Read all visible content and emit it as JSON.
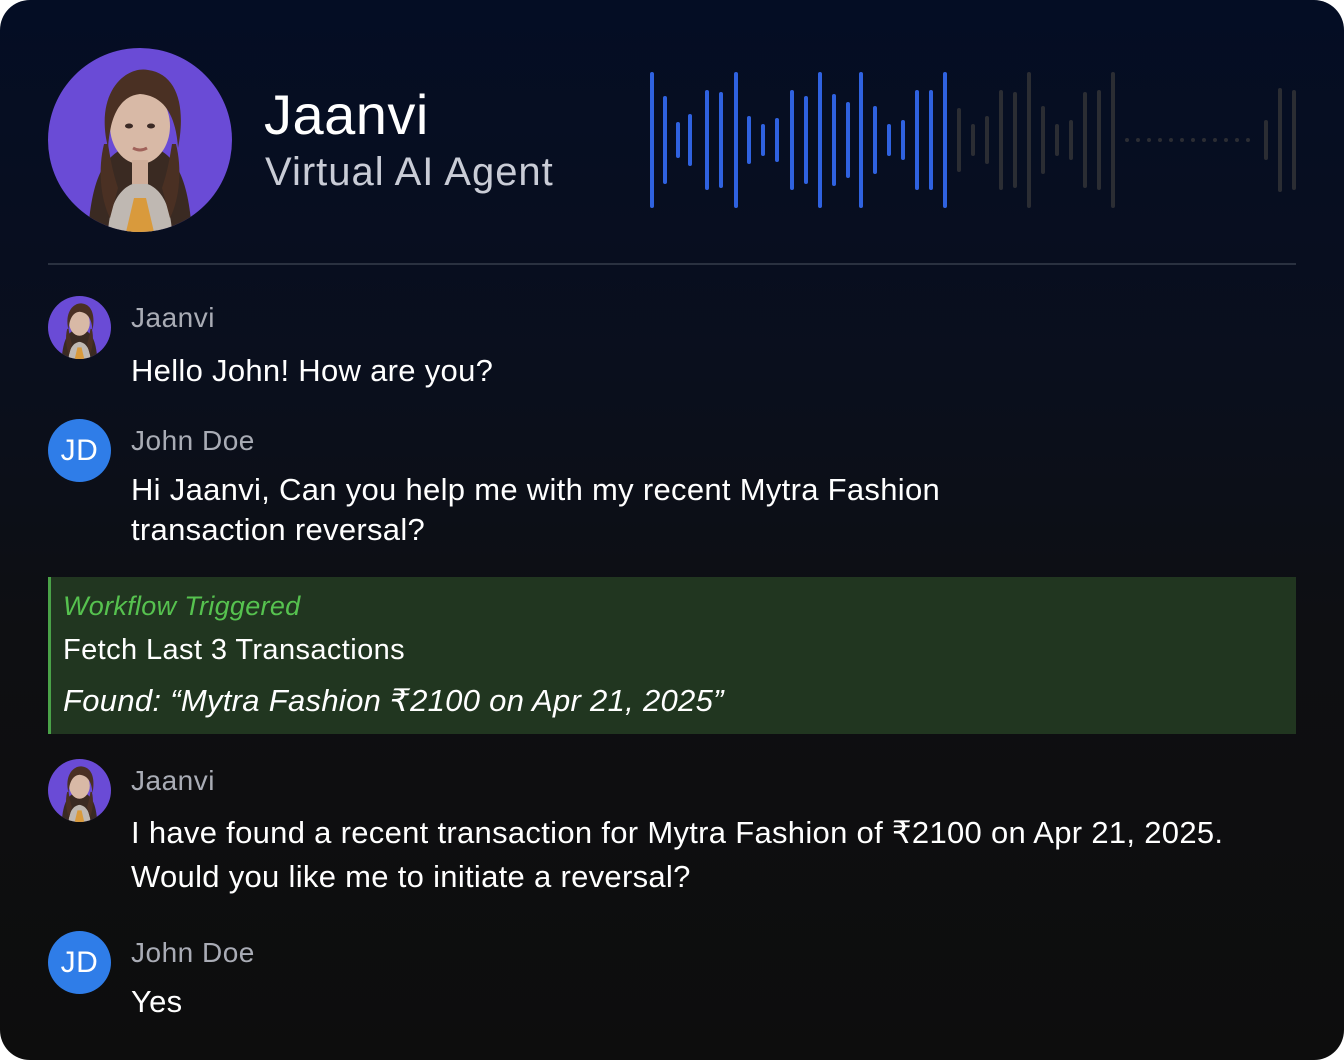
{
  "header": {
    "agent_name": "Jaanvi",
    "agent_role": "Virtual AI Agent"
  },
  "messages": [
    {
      "sender": "Jaanvi",
      "role": "agent",
      "text": "Hello John! How are you?"
    },
    {
      "sender": "John Doe",
      "role": "user",
      "initials": "JD",
      "text": "Hi Jaanvi, Can you help me with my recent Mytra Fashion transaction reversal?"
    },
    {
      "sender": "Jaanvi",
      "role": "agent",
      "text": "I have found a recent transaction for Mytra Fashion of ₹2100 on Apr 21, 2025. Would you like me to initiate a reversal?"
    },
    {
      "sender": "John Doe",
      "role": "user",
      "initials": "JD",
      "text": "Yes"
    }
  ],
  "workflow": {
    "title": "Workflow Triggered",
    "step": "Fetch Last 3 Transactions",
    "result": "Found: “Mytra Fashion ₹2100 on Apr 21, 2025”"
  },
  "colors": {
    "accent_wave": "#2f62e0",
    "avatar_bg": "#6a4bd6",
    "user_avatar_bg": "#2f7de8",
    "workflow_bg": "#213620",
    "workflow_title": "#56c24f"
  }
}
